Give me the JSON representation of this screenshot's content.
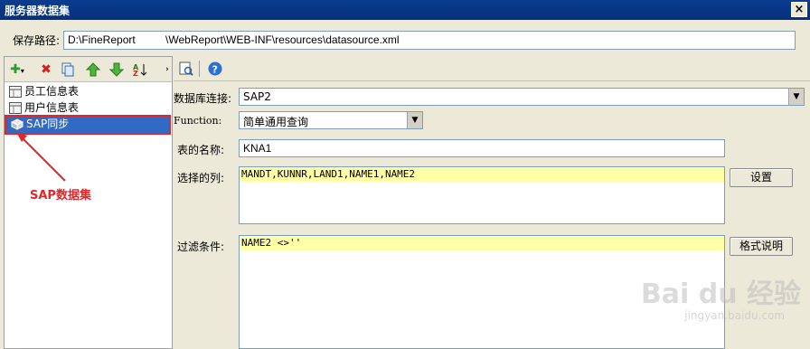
{
  "window": {
    "title": "服务器数据集",
    "close_label": "×"
  },
  "path": {
    "label": "保存路径:",
    "value": "D:\\FineReport          \\WebReport\\WEB-INF\\resources\\datasource.xml"
  },
  "left_toolbar": {
    "icons": [
      "add-icon",
      "delete-icon",
      "copy-icon",
      "move-up-icon",
      "move-down-icon",
      "sort-icon"
    ]
  },
  "tree": {
    "items": [
      {
        "label": "员工信息表",
        "icon": "database-table-icon"
      },
      {
        "label": "用户信息表",
        "icon": "database-table-icon"
      },
      {
        "label": "SAP同步",
        "icon": "sap-dataset-icon",
        "selected": true
      }
    ]
  },
  "annotation": {
    "label": "SAP数据集",
    "color": "#e0282b"
  },
  "right_toolbar": {
    "icons": [
      "preview-icon",
      "help-icon"
    ]
  },
  "form": {
    "db_label": "数据库连接:",
    "db_value": "SAP2",
    "function_label": "Function:",
    "function_value": "简单通用查询",
    "table_label": "表的名称:",
    "table_value": "KNA1",
    "columns_label": "选择的列:",
    "columns_value": "MANDT,KUNNR,LAND1,NAME1,NAME2",
    "columns_button": "设置",
    "filter_label": "过滤条件:",
    "filter_value": "NAME2 <>''",
    "filter_button": "格式说明"
  },
  "watermark": {
    "brand": "Bai du 经验",
    "url": "jingyan.baidu.com"
  },
  "colors": {
    "selection": "#316ac5",
    "highlight": "#ffffa8",
    "title_bar": "#0a3d8f"
  }
}
